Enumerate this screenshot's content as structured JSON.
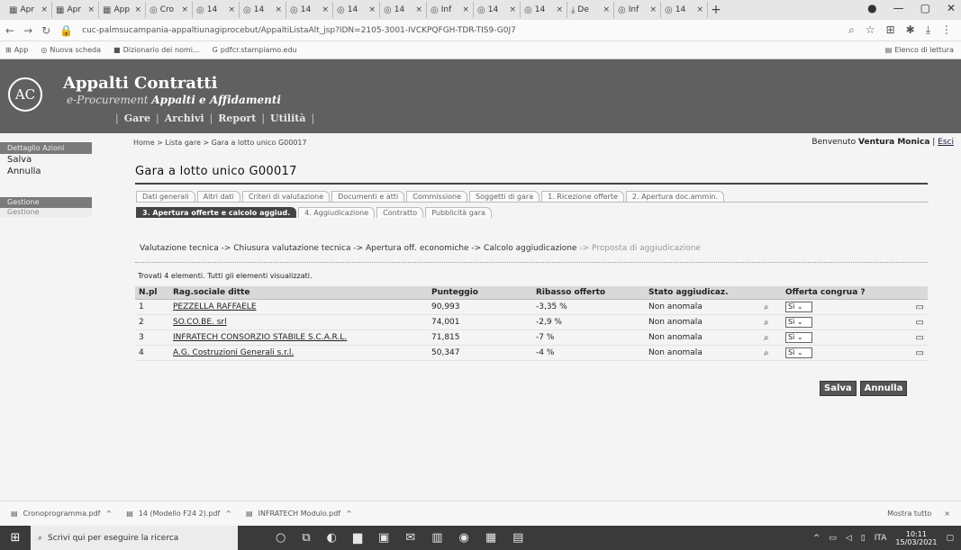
{
  "browser": {
    "tabs": [
      {
        "label": "Apr",
        "icon": "app-icon"
      },
      {
        "label": "Apr",
        "icon": "app-icon"
      },
      {
        "label": "App",
        "icon": "app-icon"
      },
      {
        "label": "Cro",
        "icon": "globe-icon"
      },
      {
        "label": "14",
        "icon": "globe-icon"
      },
      {
        "label": "14",
        "icon": "globe-icon"
      },
      {
        "label": "14",
        "icon": "globe-icon"
      },
      {
        "label": "14",
        "icon": "globe-icon"
      },
      {
        "label": "14",
        "icon": "globe-icon"
      },
      {
        "label": "Inf",
        "icon": "globe-icon"
      },
      {
        "label": "14",
        "icon": "globe-icon"
      },
      {
        "label": "14",
        "icon": "globe-icon"
      },
      {
        "label": "De",
        "icon": "download-icon"
      },
      {
        "label": "Inf",
        "icon": "globe-icon"
      },
      {
        "label": "14",
        "icon": "globe-icon"
      }
    ],
    "url": "cuc-palmsucampania-appaltiunagiprocebut/AppaltiListaAlt_jsp?IDN=2105-3001-IVCKPQFGH-TDR-TIS9-G0J7",
    "bookmarks": [
      "App",
      "Nuova scheda",
      "Dizionario dei nomi...",
      "pdfcr.stampiamo.edu"
    ],
    "reading_list": "Elenco di lettura"
  },
  "app": {
    "logo": "AC",
    "title": "Appalti Contratti",
    "subtitle_prefix": "e-Procurement",
    "subtitle_main": "Appalti e Affidamenti",
    "nav": [
      "Gare",
      "Archivi",
      "Report",
      "Utilità"
    ]
  },
  "sidebar": {
    "heading": "Dettaglio Azioni",
    "items": [
      "Salva",
      "Annulla"
    ],
    "heading2": "Gestione",
    "items2": [
      "Gestione"
    ]
  },
  "page": {
    "breadcrumb": "Home > Lista gare > Gara a lotto unico G00017",
    "welcome_prefix": "Benvenuto",
    "user": "Ventura Monica",
    "logout": "Esci",
    "title": "Gara a lotto unico G00017",
    "tabs_row1": [
      "Dati generali",
      "Altri dati",
      "Criteri di valutazione",
      "Documenti e atti",
      "Commissione",
      "Soggetti di gara",
      "1. Ricezione offerte",
      "2. Apertura doc.ammin."
    ],
    "tabs_row2": [
      "3. Apertura offerte e calcolo aggiud.",
      "4. Aggiudicazione",
      "Contratto",
      "Pubblicità gara"
    ],
    "steps": "Valutazione tecnica -> Chiusura valutazione tecnica -> Apertura off. economiche -> Calcolo aggiudicazione",
    "steps_current": "-> Proposta di aggiudicazione",
    "found": "Trovati 4 elementi. Tutti gli elementi visualizzati.",
    "columns": [
      "N.pl",
      "Rag.sociale ditte",
      "Punteggio",
      "Ribasso offerto",
      "Stato aggiudicaz.",
      "",
      "Offerta congrua ?",
      ""
    ],
    "rows": [
      {
        "n": "1",
        "name": "PEZZELLA RAFFAELE",
        "score": "90,993",
        "discount": "-3,35 %",
        "state": "Non anomala",
        "congrua": "Sì"
      },
      {
        "n": "2",
        "name": "SO.CO.BE. srl",
        "score": "74,001",
        "discount": "-2,9 %",
        "state": "Non anomala",
        "congrua": "Sì"
      },
      {
        "n": "3",
        "name": "INFRATECH CONSORZIO STABILE S.C.A.R.L.",
        "score": "71,815",
        "discount": "-7 %",
        "state": "Non anomala",
        "congrua": "Sì"
      },
      {
        "n": "4",
        "name": "A.G. Costruzioni Generali s.r.l.",
        "score": "50,347",
        "discount": "-4 %",
        "state": "Non anomala",
        "congrua": "Sì"
      }
    ],
    "save_label": "Salva",
    "cancel_label": "Annulla"
  },
  "downloads": {
    "items": [
      "Cronoprogramma.pdf",
      "14 (Modello F24 2).pdf",
      "INFRATECH Modulo.pdf"
    ],
    "show_all": "Mostra tutto",
    "close": "×"
  },
  "taskbar": {
    "search_placeholder": "Scrivi qui per eseguire la ricerca",
    "lang": "ITA",
    "time": "10:11",
    "date": "15/03/2021"
  }
}
